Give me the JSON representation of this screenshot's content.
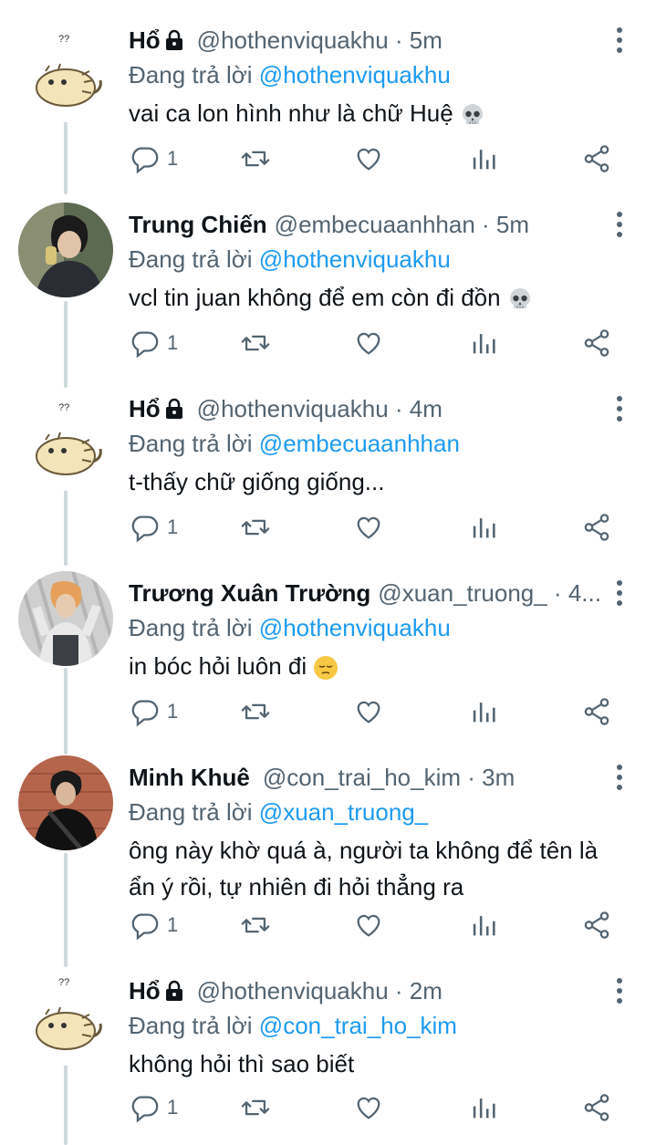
{
  "reply_label": "Đang trả lời",
  "tweets": [
    {
      "name": "Hổ",
      "locked": true,
      "handle_time": "@hothenviquakhu · 5m",
      "replying_to": "@hothenviquakhu",
      "text": "vai ca lon hình như là chữ Huệ",
      "emoji": "skull",
      "reply_count": "1",
      "avatar_caption": "??"
    },
    {
      "name": "Trung Chiến",
      "locked": false,
      "handle_time": "@embecuaanhhan · 5m",
      "replying_to": "@hothenviquakhu",
      "text": "vcl tin juan không để em còn đi đồn",
      "emoji": "skull",
      "reply_count": "1"
    },
    {
      "name": "Hổ",
      "locked": true,
      "handle_time": "@hothenviquakhu · 4m",
      "replying_to": "@embecuaanhhan",
      "text": "t-thấy chữ giống giống...",
      "emoji": "",
      "reply_count": "1",
      "avatar_caption": "??"
    },
    {
      "name": "Trương Xuân Trường",
      "locked": false,
      "handle_time": "@xuan_truong_ · 4...",
      "replying_to": "@hothenviquakhu",
      "text": "in bóc hỏi luôn đi",
      "emoji": "pensive",
      "reply_count": "1"
    },
    {
      "name": "Minh Khuê",
      "locked": false,
      "handle_time": "@con_trai_ho_kim · 3m",
      "replying_to": "@xuan_truong_",
      "text": "ông này khờ quá à, người ta không để tên là ẩn ý rồi, tự nhiên đi hỏi thẳng ra",
      "emoji": "",
      "reply_count": "1"
    },
    {
      "name": "Hổ",
      "locked": true,
      "handle_time": "@hothenviquakhu · 2m",
      "replying_to": "@con_trai_ho_kim",
      "text": "không hỏi thì sao biết",
      "emoji": "",
      "reply_count": "1",
      "avatar_caption": "??"
    }
  ],
  "icons": {
    "reply": "reply-icon",
    "retweet": "retweet-icon",
    "like": "heart-icon",
    "views": "views-icon",
    "share": "share-icon",
    "more": "more-icon",
    "lock": "lock-icon"
  },
  "colors": {
    "accent": "#1d9bf0",
    "secondary_text": "#536471",
    "thread_line": "#cfd9de"
  }
}
